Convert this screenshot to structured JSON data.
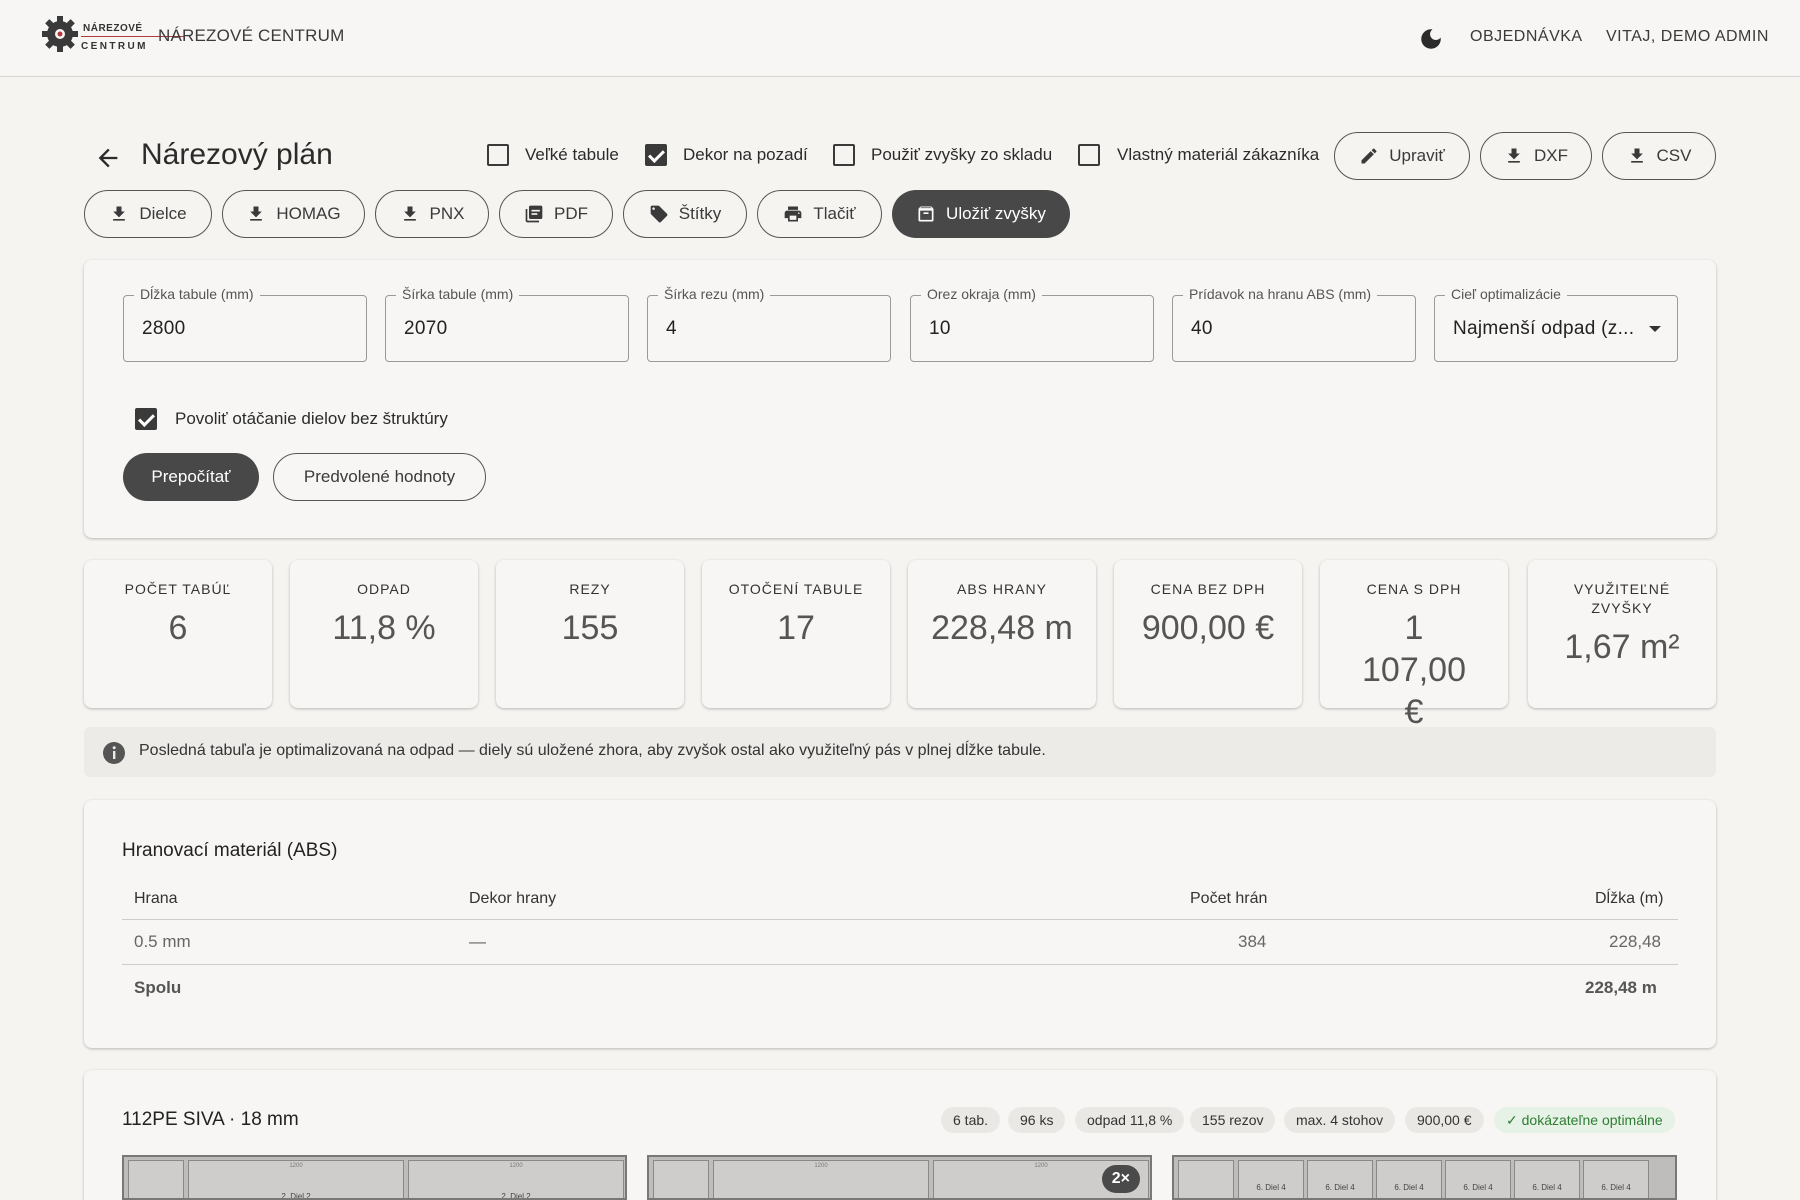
{
  "topbar": {
    "logo_line1": "NÁREZOVÉ",
    "logo_line2": "CENTRUM",
    "app_name": "NÁREZOVÉ CENTRUM",
    "theme_icon": "moon-icon",
    "nav_order": "OBJEDNÁVKA",
    "nav_user": "VITAJ, DEMO ADMIN"
  },
  "header": {
    "back_icon": "arrow-left-icon",
    "title": "Nárezový plán",
    "checkboxes": [
      {
        "label": "Veľké tabule",
        "checked": false
      },
      {
        "label": "Dekor na pozadí",
        "checked": true
      },
      {
        "label": "Použiť zvyšky zo skladu",
        "checked": false
      },
      {
        "label": "Vlastný materiál zákazníka",
        "checked": false
      }
    ],
    "right_buttons": [
      {
        "label": "Upraviť",
        "icon": "pencil-icon"
      },
      {
        "label": "DXF",
        "icon": "download-icon"
      },
      {
        "label": "CSV",
        "icon": "download-icon"
      }
    ]
  },
  "toolbar": {
    "buttons": [
      {
        "label": "Dielce",
        "icon": "download-icon"
      },
      {
        "label": "HOMAG",
        "icon": "download-icon"
      },
      {
        "label": "PNX",
        "icon": "download-icon"
      },
      {
        "label": "PDF",
        "icon": "pdf-icon"
      },
      {
        "label": "Štítky",
        "icon": "label-icon"
      },
      {
        "label": "Tlačiť",
        "icon": "printer-icon"
      },
      {
        "label": "Uložiť zvyšky",
        "icon": "archive-icon"
      }
    ]
  },
  "params": {
    "fields": [
      {
        "label": "Dĺžka tabule (mm)",
        "value": "2800"
      },
      {
        "label": "Šírka tabule (mm)",
        "value": "2070"
      },
      {
        "label": "Šírka rezu (mm)",
        "value": "4"
      },
      {
        "label": "Orez okraja (mm)",
        "value": "10"
      },
      {
        "label": "Prídavok na hranu ABS (mm)",
        "value": "40"
      },
      {
        "label": "Cieľ optimalizácie",
        "value": "Najmenší odpad (z..."
      }
    ],
    "rotate_label": "Povoliť otáčanie dielov bez štruktúry",
    "rotate_checked": true,
    "recalc_button": "Prepočítať",
    "defaults_button": "Predvolené hodnoty"
  },
  "stats": [
    {
      "label": "POČET TABÚĽ",
      "value": "6"
    },
    {
      "label": "ODPAD",
      "value": "11,8 %"
    },
    {
      "label": "REZY",
      "value": "155"
    },
    {
      "label": "OTOČENÍ TABULE",
      "value": "17"
    },
    {
      "label": "ABS HRANY",
      "value": "228,48 m"
    },
    {
      "label": "CENA BEZ DPH",
      "value": "900,00 €"
    },
    {
      "label": "CENA S DPH",
      "value": "1 107,00 €"
    },
    {
      "label": "VYUŽITEĽNÉ ZVYŠKY",
      "value": "1,67 m²"
    }
  ],
  "info": {
    "icon": "info-icon",
    "text": "Posledná tabuľa je optimalizovaná na odpad — diely sú uložené zhora, aby zvyšok ostal ako využiteľný pás v plnej dĺžke tabule."
  },
  "edge_table": {
    "title": "Hranovací materiál (ABS)",
    "headers": [
      "Hrana",
      "Dekor hrany",
      "Počet hrán",
      "Dĺžka (m)"
    ],
    "rows": [
      [
        "0.5 mm",
        "—",
        "384",
        "228,48"
      ]
    ],
    "total_label": "Spolu",
    "total_value": "228,48 m"
  },
  "material": {
    "title": "112PE SIVA · 18 mm",
    "chips": [
      "6 tab.",
      "96 ks",
      "odpad 11,8 %",
      "155 rezov",
      "max. 4 stohov",
      "900,00 €",
      "✓ dokázateľne optimálne"
    ],
    "sheet1_parts": [
      "2. Diel 2",
      "2. Diel 2"
    ],
    "sheet1_dims": [
      "1200",
      "1200"
    ],
    "sheet2_dims": [
      "1200",
      "1200"
    ],
    "sheet2_badge": "2×",
    "sheet3_parts": [
      "6. Diel 4",
      "6. Diel 4",
      "6. Diel 4",
      "6. Diel 4",
      "6. Diel 4",
      "6. Diel 4"
    ]
  },
  "colors": {
    "background": "#f6f4f1",
    "dark_button": "#484848",
    "success": "#2e7d32"
  }
}
